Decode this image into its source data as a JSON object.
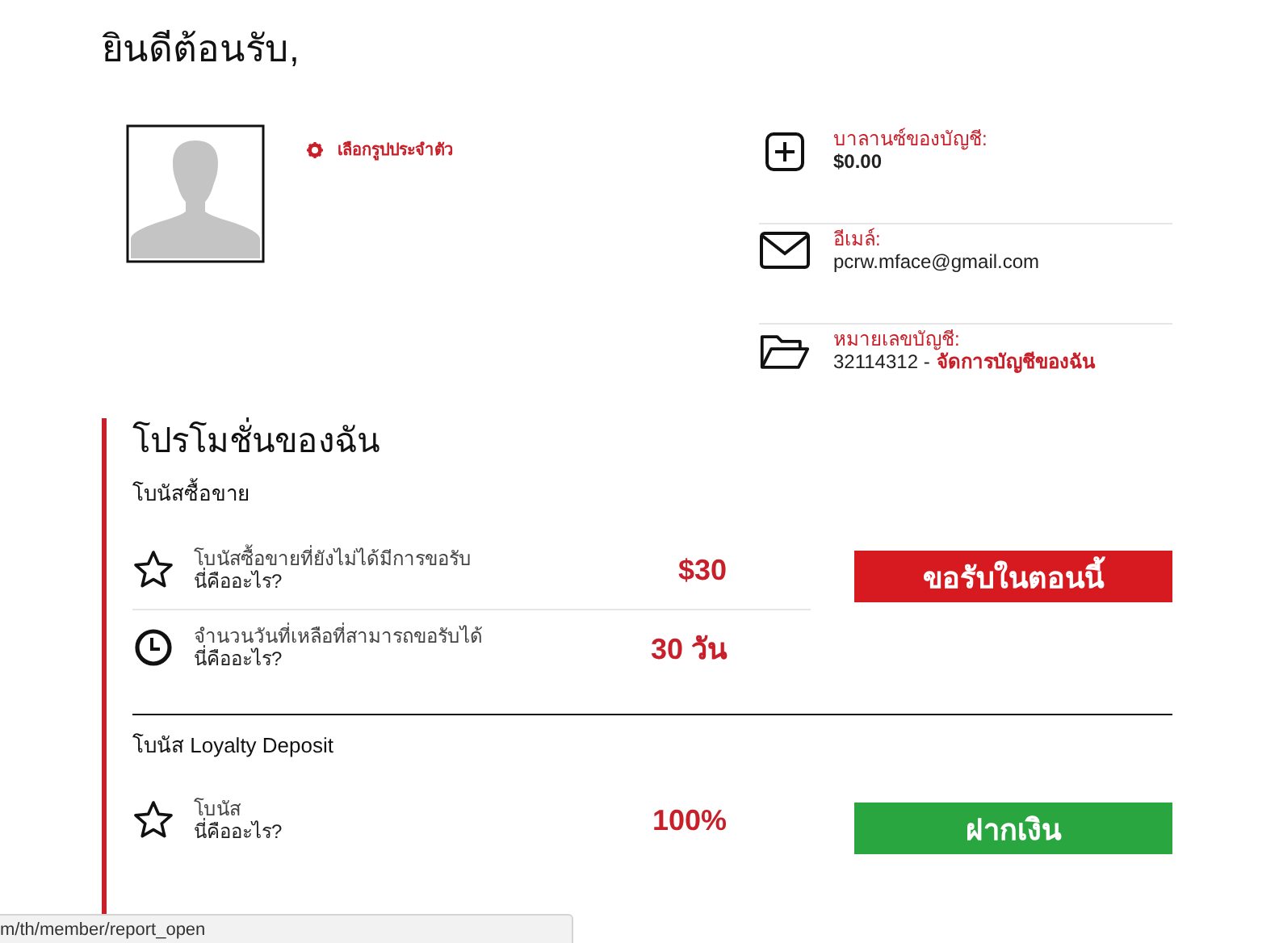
{
  "greeting": "ยินดีต้อนรับ,",
  "profile": {
    "change_photo": "เลือกรูปประจำตัว"
  },
  "account": [
    {
      "kind": "balance",
      "label": "บาลานซ์ของบัญชี:",
      "value": "$0.00"
    },
    {
      "kind": "email",
      "label": "อีเมล์:",
      "value": "pcrw.mface@gmail.com"
    },
    {
      "kind": "account",
      "label": "หมายเลขบัญชี:",
      "value": "32114312 -",
      "link": "จัดการบัญชีของฉัน"
    }
  ],
  "promotions": {
    "title": "โปรโมชั่นของฉัน",
    "groups": [
      {
        "title": "โบนัสซื้อขาย",
        "button": {
          "label": "ขอรับในตอนนี้",
          "kind": "claim"
        },
        "rows": [
          {
            "kind": "star",
            "label": "โบนัสซื้อขายที่ยังไม่ได้มีการขอรับ",
            "help": "นี่คืออะไร?",
            "value": "$30"
          },
          {
            "kind": "clock",
            "label": "จำนวนวันที่เหลือที่สามารถขอรับได้",
            "help": "นี่คืออะไร?",
            "value": "30 วัน"
          }
        ]
      },
      {
        "title": "โบนัส Loyalty Deposit",
        "button": {
          "label": "ฝากเงิน",
          "kind": "deposit"
        },
        "rows": [
          {
            "kind": "star",
            "label": "โบนัส",
            "help": "นี่คืออะไร?",
            "value": "100%"
          }
        ]
      }
    ]
  },
  "status_bar": "m/th/member/report_open"
}
